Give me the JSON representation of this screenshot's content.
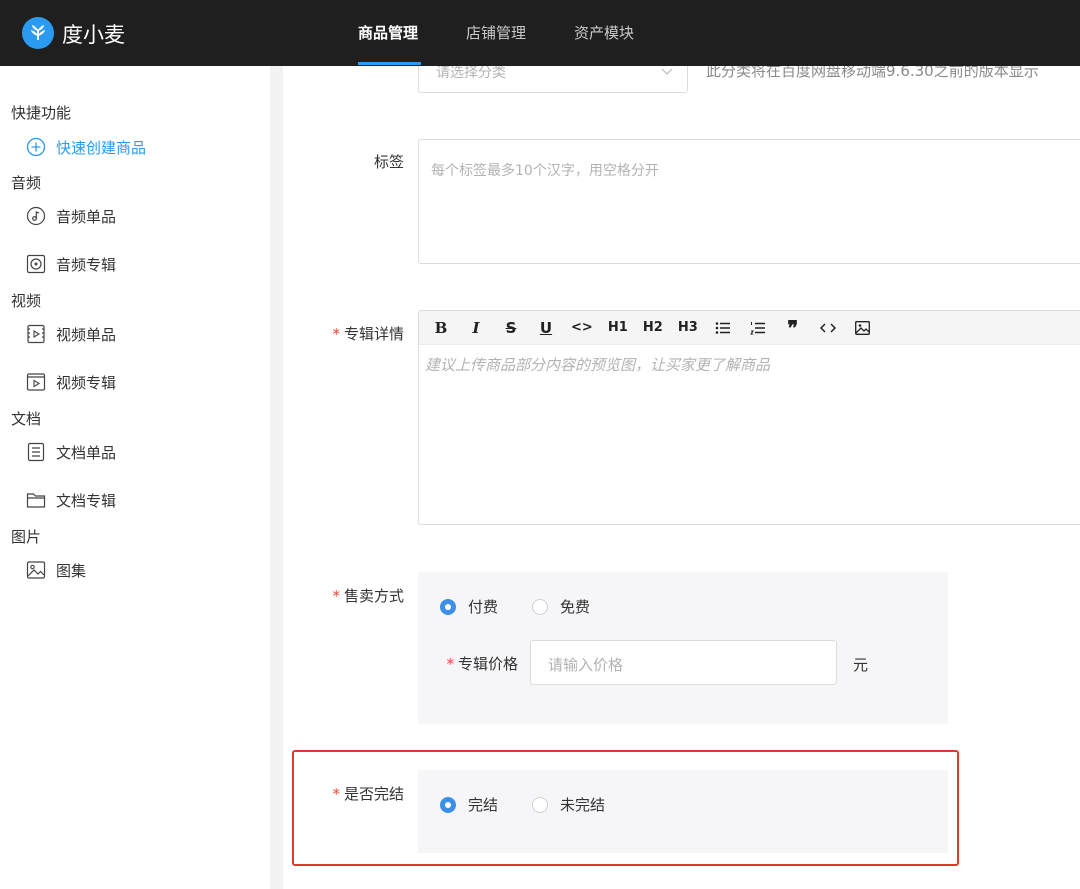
{
  "app": {
    "brand": "度小麦",
    "logo_icon": "wheat-logo-icon",
    "accent": "#2a9bf0"
  },
  "nav": {
    "tabs": [
      {
        "label": "商品管理",
        "active": true
      },
      {
        "label": "店铺管理"
      },
      {
        "label": "资产模块"
      }
    ]
  },
  "sidebar": {
    "quick": {
      "title": "快捷功能",
      "item": "快速创建商品"
    },
    "audio": {
      "title": "音频",
      "single": "音频单品",
      "album": "音频专辑"
    },
    "video": {
      "title": "视频",
      "single": "视频单品",
      "album": "视频专辑"
    },
    "doc": {
      "title": "文档",
      "single": "文档单品",
      "album": "文档专辑"
    },
    "image": {
      "title": "图片",
      "gallery": "图集"
    }
  },
  "form": {
    "category": {
      "placeholder": "请选择分类",
      "hint": "此分类将在百度网盘移动端9.6.30之前的版本显示"
    },
    "tags": {
      "label": "标签",
      "placeholder": "每个标签最多10个汉字，用空格分开"
    },
    "detail": {
      "required": "*",
      "label": "专辑详情",
      "toolbar": [
        "B",
        "I",
        "S",
        "U",
        "<>",
        "H1",
        "H2",
        "H3",
        "bulleted-list-icon",
        "numbered-list-icon",
        "quote-icon",
        "code-icon",
        "image-icon"
      ],
      "placeholder": "建议上传商品部分内容的预览图，让买家更了解商品"
    },
    "sale": {
      "required": "*",
      "label": "售卖方式",
      "options": [
        "付费",
        "免费"
      ],
      "selected": "付费",
      "price": {
        "required": "*",
        "label": "专辑价格",
        "placeholder": "请输入价格",
        "unit": "元"
      }
    },
    "completed": {
      "required": "*",
      "label": "是否完结",
      "options": [
        "完结",
        "未完结"
      ],
      "selected": "完结"
    }
  }
}
